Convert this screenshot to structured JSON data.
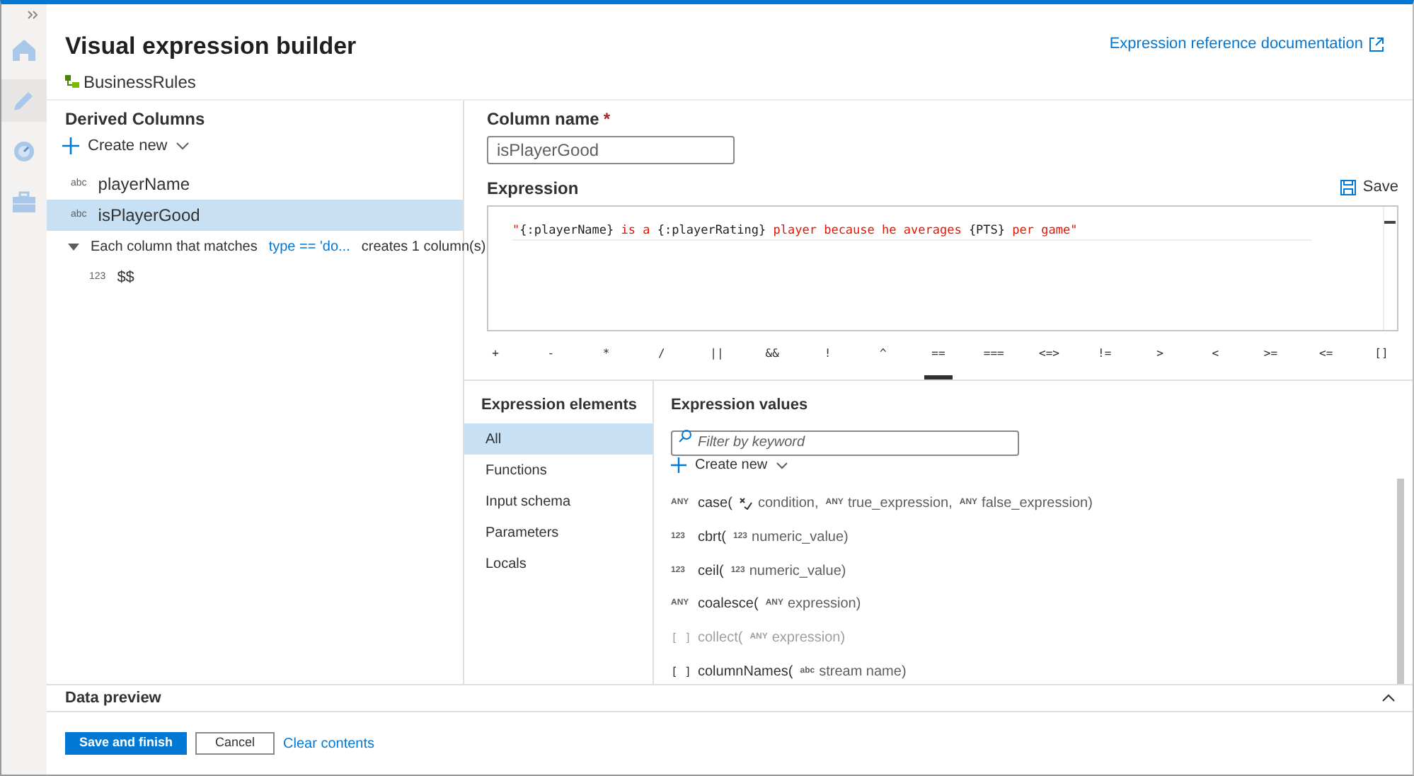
{
  "title": "Visual expression builder",
  "subtitle": "BusinessRules",
  "doc_link": "Expression reference documentation",
  "nav": [
    {
      "kind": "home",
      "selected": false
    },
    {
      "kind": "pencil",
      "selected": true
    },
    {
      "kind": "gauge",
      "selected": false
    },
    {
      "kind": "toolbox",
      "selected": false
    }
  ],
  "derived": {
    "heading": "Derived Columns",
    "create_new": "Create new",
    "columns": [
      {
        "type": "abc",
        "name": "playerName",
        "selected": false
      },
      {
        "type": "abc",
        "name": "isPlayerGood",
        "selected": true
      }
    ],
    "pattern": {
      "expanded": true,
      "label": "Each column that matches",
      "condition": "type == 'do...",
      "result": "creates 1 column(s)",
      "children": [
        {
          "type": "123",
          "name": "$$"
        }
      ]
    }
  },
  "column_name": {
    "label": "Column name",
    "required": true,
    "value": "isPlayerGood"
  },
  "expression": {
    "label": "Expression",
    "save": "Save",
    "segments": [
      {
        "kind": "string",
        "text": "\""
      },
      {
        "kind": "code",
        "text": "{:playerName}"
      },
      {
        "kind": "string",
        "text": " is a "
      },
      {
        "kind": "code",
        "text": "{:playerRating}"
      },
      {
        "kind": "string",
        "text": " player because he averages "
      },
      {
        "kind": "code",
        "text": "{PTS}"
      },
      {
        "kind": "string",
        "text": " per game\""
      }
    ]
  },
  "operators": [
    {
      "label": "+",
      "selected": false
    },
    {
      "label": "-",
      "selected": false
    },
    {
      "label": "*",
      "selected": false
    },
    {
      "label": "/",
      "selected": false
    },
    {
      "label": "||",
      "selected": false
    },
    {
      "label": "&&",
      "selected": false
    },
    {
      "label": "!",
      "selected": false
    },
    {
      "label": "^",
      "selected": false
    },
    {
      "label": "==",
      "selected": true
    },
    {
      "label": "===",
      "selected": false
    },
    {
      "label": "<=>",
      "selected": false
    },
    {
      "label": "!=",
      "selected": false
    },
    {
      "label": ">",
      "selected": false
    },
    {
      "label": "<",
      "selected": false
    },
    {
      "label": ">=",
      "selected": false
    },
    {
      "label": "<=",
      "selected": false
    },
    {
      "label": "[]",
      "selected": false
    }
  ],
  "elements": {
    "heading": "Expression elements",
    "items": [
      {
        "label": "All",
        "selected": true
      },
      {
        "label": "Functions",
        "selected": false
      },
      {
        "label": "Input schema",
        "selected": false
      },
      {
        "label": "Parameters",
        "selected": false
      },
      {
        "label": "Locals",
        "selected": false
      }
    ]
  },
  "values": {
    "heading": "Expression values",
    "placeholder": "Filter by keyword",
    "create_new": "Create new",
    "functions": [
      {
        "type": "ANY",
        "name": "case(",
        "disabled": false,
        "params": [
          {
            "kind": "boolean",
            "text": "condition,"
          },
          {
            "kind": "badge",
            "type": "ANY",
            "text": "true_expression,"
          },
          {
            "kind": "badge",
            "type": "ANY",
            "text": "false_expression)"
          }
        ]
      },
      {
        "type": "123",
        "name": "cbrt(",
        "disabled": false,
        "params": [
          {
            "kind": "badge",
            "type": "123",
            "text": "numeric_value)"
          }
        ]
      },
      {
        "type": "123",
        "name": "ceil(",
        "disabled": false,
        "params": [
          {
            "kind": "badge",
            "type": "123",
            "text": "numeric_value)"
          }
        ]
      },
      {
        "type": "ANY",
        "name": "coalesce(",
        "disabled": false,
        "params": [
          {
            "kind": "badge",
            "type": "ANY",
            "text": "expression)"
          }
        ]
      },
      {
        "type": "[ ]",
        "name": "collect(",
        "disabled": true,
        "params": [
          {
            "kind": "badge",
            "type": "ANY",
            "text": "expression)"
          }
        ]
      },
      {
        "type": "[ ]",
        "name": "columnNames(",
        "disabled": false,
        "params": [
          {
            "kind": "badge",
            "type": "abc",
            "text": "stream name)"
          }
        ]
      }
    ]
  },
  "data_preview": {
    "label": "Data preview",
    "expanded": false
  },
  "buttons": [
    {
      "kind": "primary",
      "label": "Save and finish"
    },
    {
      "kind": "secondary",
      "label": "Cancel"
    },
    {
      "kind": "link",
      "label": "Clear contents"
    }
  ]
}
